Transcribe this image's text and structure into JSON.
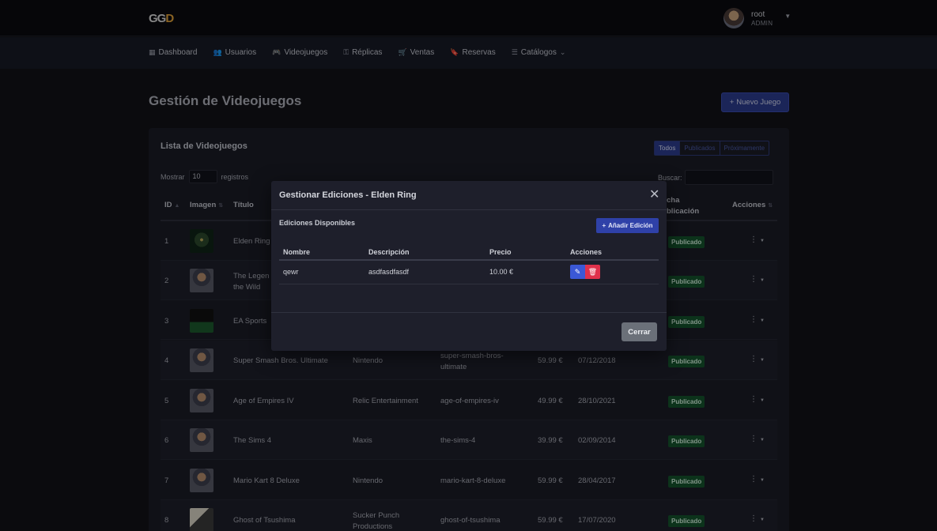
{
  "app": {
    "logo_text": "GG",
    "logo_accent": "D"
  },
  "user": {
    "name": "root",
    "role": "ADMIN"
  },
  "nav": [
    {
      "label": "Dashboard",
      "icon": "grid-icon"
    },
    {
      "label": "Usuarios",
      "icon": "users-icon"
    },
    {
      "label": "Videojuegos",
      "icon": "gamepad-icon"
    },
    {
      "label": "Réplicas",
      "icon": "key-icon"
    },
    {
      "label": "Ventas",
      "icon": "cart-icon"
    },
    {
      "label": "Reservas",
      "icon": "bookmark-icon"
    },
    {
      "label": "Catálogos",
      "icon": "list-icon"
    }
  ],
  "page": {
    "title": "Gestión de Videojuegos",
    "new_button": "Nuevo Juego"
  },
  "list": {
    "title": "Lista de Videojuegos",
    "filters": [
      "Todos",
      "Publicados",
      "Próximamente"
    ],
    "show_label": "Mostrar",
    "page_size": "10",
    "records_label": "registros",
    "search_label": "Buscar:",
    "headers": {
      "id": "ID",
      "image": "Imagen",
      "title": "Título",
      "date": "Fecha Publicación",
      "date_visible": "cha\nblicación",
      "actions": "Acciones"
    },
    "rows": [
      {
        "id": "1",
        "title": "Elden Ring",
        "publisher": "",
        "slug": "",
        "price": "",
        "date": "",
        "status": "Publicado"
      },
      {
        "id": "2",
        "title": "The Legend of Zelda: Breath of the Wild",
        "title_visible": "The Legen\nthe Wild",
        "publisher": "",
        "slug": "",
        "price": "",
        "date": "",
        "status": "Publicado"
      },
      {
        "id": "3",
        "title": "EA Sports",
        "publisher": "",
        "slug": "",
        "price": "",
        "date": "",
        "status": "Publicado"
      },
      {
        "id": "4",
        "title": "Super Smash Bros. Ultimate",
        "publisher": "Nintendo",
        "slug": "super-smash-bros-ultimate",
        "price": "59.99 €",
        "date": "07/12/2018",
        "status": "Publicado"
      },
      {
        "id": "5",
        "title": "Age of Empires IV",
        "publisher": "Relic Entertainment",
        "slug": "age-of-empires-iv",
        "price": "49.99 €",
        "date": "28/10/2021",
        "status": "Publicado"
      },
      {
        "id": "6",
        "title": "The Sims 4",
        "publisher": "Maxis",
        "slug": "the-sims-4",
        "price": "39.99 €",
        "date": "02/09/2014",
        "status": "Publicado"
      },
      {
        "id": "7",
        "title": "Mario Kart 8 Deluxe",
        "publisher": "Nintendo",
        "slug": "mario-kart-8-deluxe",
        "price": "59.99 €",
        "date": "28/04/2017",
        "status": "Publicado"
      },
      {
        "id": "8",
        "title": "Ghost of Tsushima",
        "publisher": "Sucker Punch Productions",
        "slug": "ghost-of-tsushima",
        "price": "59.99 €",
        "date": "17/07/2020",
        "status": "Publicado"
      }
    ]
  },
  "modal": {
    "title": "Gestionar Ediciones - Elden Ring",
    "subtitle": "Ediciones Disponibles",
    "add_button": "Añadir Edición",
    "headers": {
      "name": "Nombre",
      "desc": "Descripción",
      "price": "Precio",
      "actions": "Acciones"
    },
    "rows": [
      {
        "name": "qewr",
        "desc": "asdfasdfasdf",
        "price": "10.00 €"
      }
    ],
    "close_button": "Cerrar"
  }
}
